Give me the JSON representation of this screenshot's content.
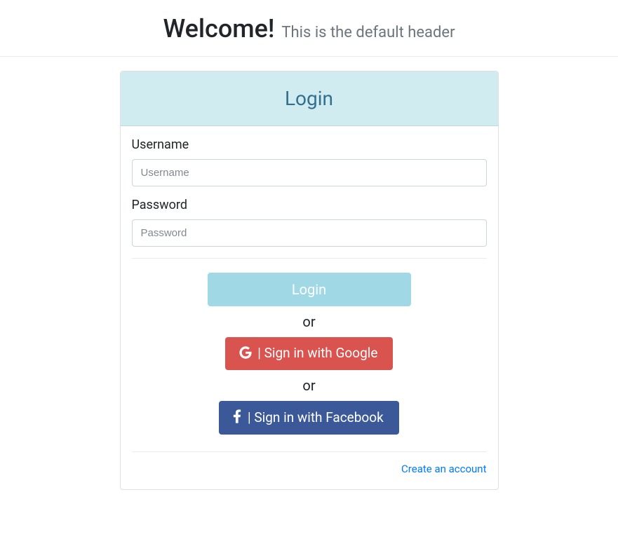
{
  "header": {
    "title": "Welcome!",
    "subtitle": "This is the default header"
  },
  "card": {
    "title": "Login"
  },
  "form": {
    "username": {
      "label": "Username",
      "placeholder": "Username",
      "value": ""
    },
    "password": {
      "label": "Password",
      "placeholder": "Password",
      "value": ""
    },
    "login_button": "Login",
    "or_text": "or",
    "google_button": " | Sign in with Google",
    "facebook_button": " | Sign in with Facebook",
    "create_account": "Create an account"
  }
}
